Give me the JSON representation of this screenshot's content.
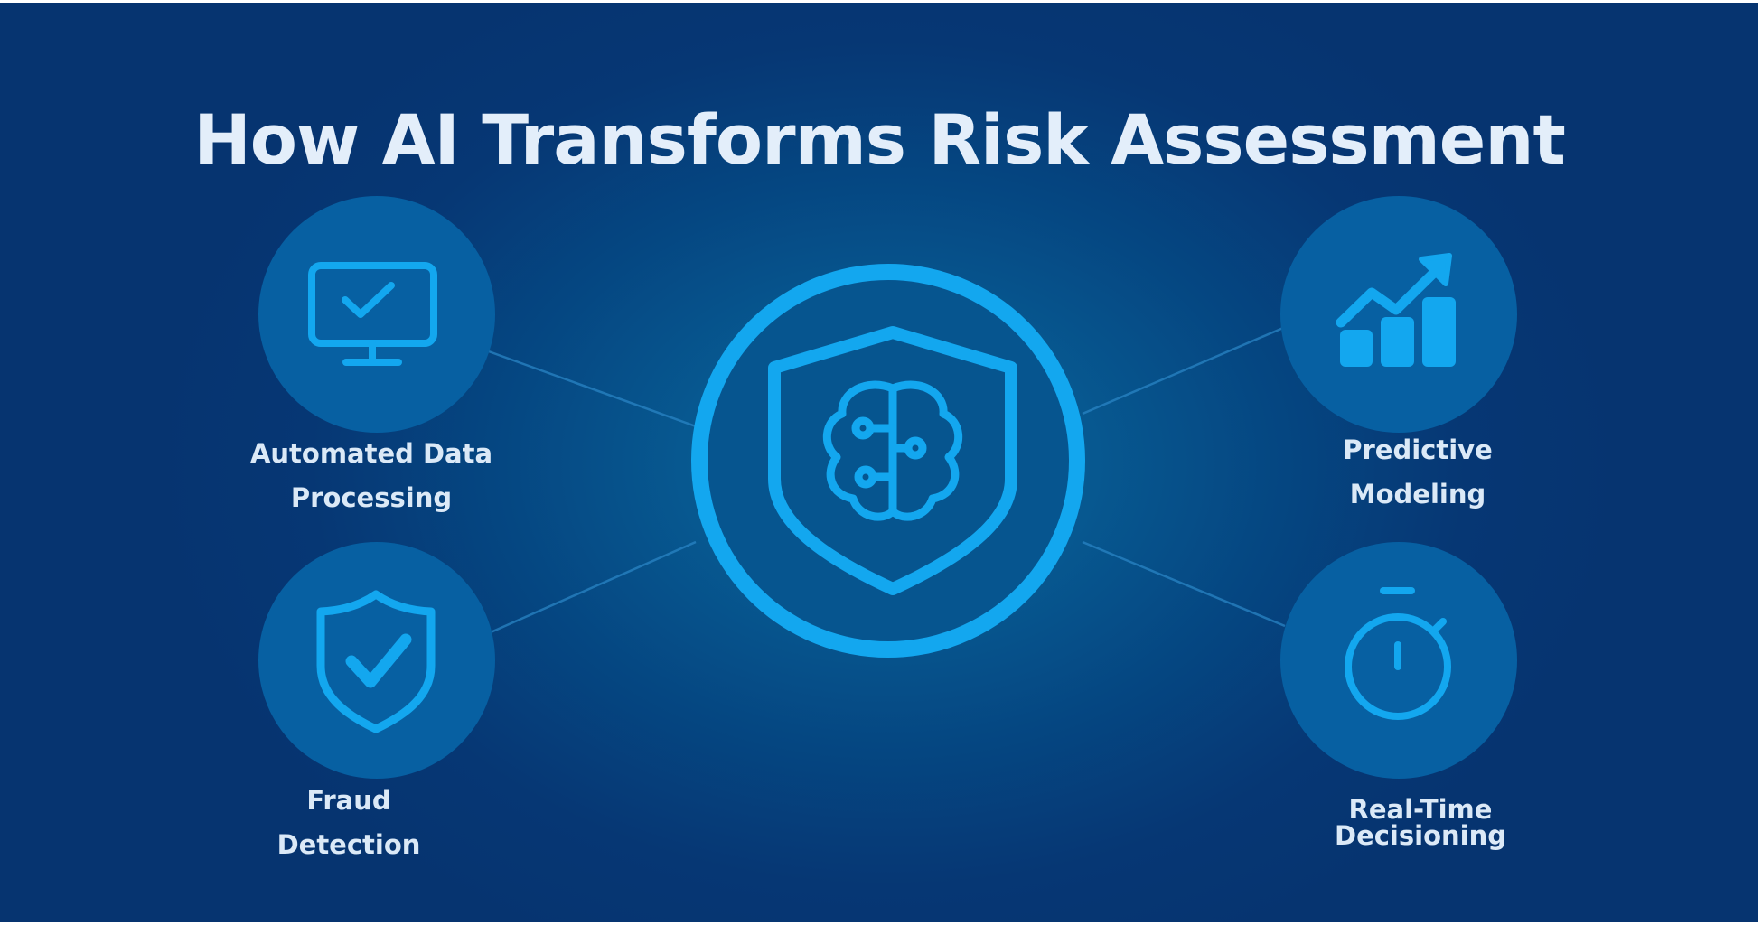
{
  "title": "How AI Transforms Risk Assessment",
  "colors": {
    "background": "#063774",
    "node_fill": "#0760a2",
    "accent": "#13a7ef",
    "text": "#dbe9f7"
  },
  "center": {
    "icon": "shield-brain-icon"
  },
  "features": [
    {
      "id": "automated-data-processing",
      "icon": "monitor-check-icon",
      "label_lines": [
        "Automated Data",
        "Processing"
      ]
    },
    {
      "id": "predictive-modeling",
      "icon": "chart-growth-icon",
      "label_lines": [
        "Predictive",
        "Modeling"
      ]
    },
    {
      "id": "fraud-detection",
      "icon": "shield-check-icon",
      "label_lines": [
        "Fraud",
        "Detection"
      ]
    },
    {
      "id": "real-time-decisioning",
      "icon": "stopwatch-icon",
      "label_lines": [
        "Real-Time",
        "Decisioning"
      ]
    }
  ]
}
